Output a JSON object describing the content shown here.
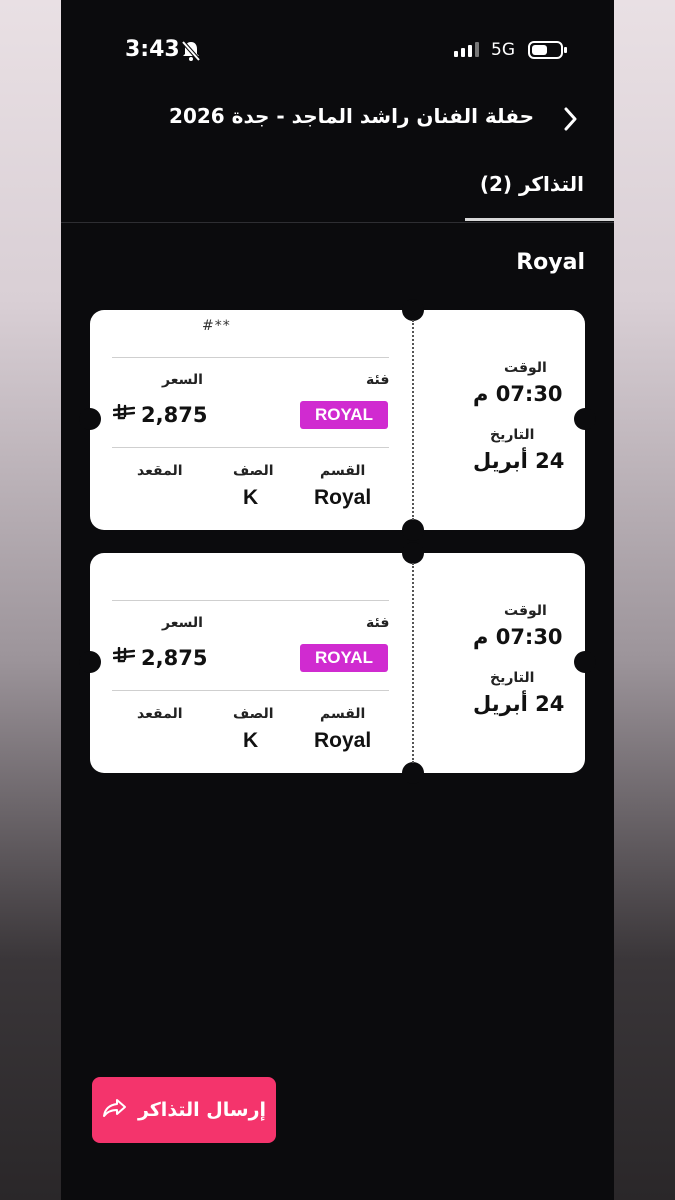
{
  "status_bar": {
    "time": "3:43",
    "network": "5G"
  },
  "header": {
    "title": "حفلة الفنان راشد الماجد - جدة 2026"
  },
  "tabs": [
    {
      "label": "التذاكر (2)"
    }
  ],
  "section": {
    "label": "Royal"
  },
  "tickets": [
    {
      "ticket_no": "#**",
      "category_label": "فئة",
      "category_value": "ROYAL",
      "price_label": "السعر",
      "price_value": "2,875",
      "currency_symbol": "⃁",
      "section_label": "القسم",
      "section_value": "Royal",
      "row_label": "الصف",
      "row_value": "K",
      "seat_label": "المقعد",
      "seat_value": "",
      "time_label": "الوقت",
      "time_value": "07:30 م",
      "date_label": "التاريخ",
      "date_value": "24 أبريل"
    },
    {
      "ticket_no": "",
      "category_label": "فئة",
      "category_value": "ROYAL",
      "price_label": "السعر",
      "price_value": "2,875",
      "currency_symbol": "⃁",
      "section_label": "القسم",
      "section_value": "Royal",
      "row_label": "الصف",
      "row_value": "K",
      "seat_label": "المقعد",
      "seat_value": "",
      "time_label": "الوقت",
      "time_value": "07:30 م",
      "date_label": "التاريخ",
      "date_value": "24 أبريل"
    }
  ],
  "actions": {
    "send_label": "إرسال التذاكر"
  },
  "colors": {
    "badge": "#d02bd0",
    "send_button": "#f4346c",
    "background": "#0b0b0d"
  }
}
